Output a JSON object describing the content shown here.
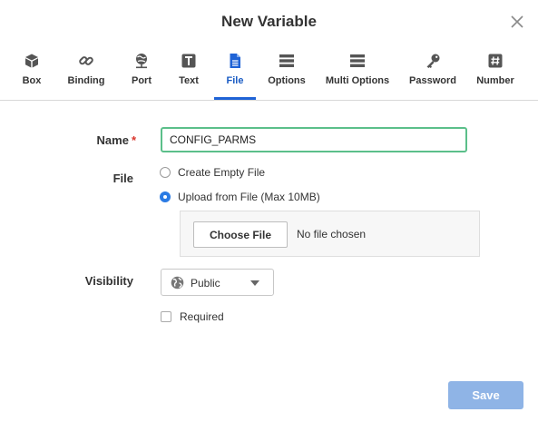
{
  "dialog": {
    "title": "New Variable",
    "close_icon": "close-icon"
  },
  "tabs": [
    {
      "label": "Box",
      "icon": "cube-icon"
    },
    {
      "label": "Binding",
      "icon": "link-icon"
    },
    {
      "label": "Port",
      "icon": "network-icon"
    },
    {
      "label": "Text",
      "icon": "text-icon"
    },
    {
      "label": "File",
      "icon": "file-icon",
      "active": true
    },
    {
      "label": "Options",
      "icon": "list-icon"
    },
    {
      "label": "Multi Options",
      "icon": "multi-list-icon"
    },
    {
      "label": "Password",
      "icon": "key-icon"
    },
    {
      "label": "Number",
      "icon": "hash-icon"
    }
  ],
  "form": {
    "name_label": "Name",
    "required_marker": "*",
    "name_value": "CONFIG_PARMS",
    "file_label": "File",
    "file_options": [
      {
        "label": "Create Empty File",
        "checked": false
      },
      {
        "label": "Upload from File (Max 10MB)",
        "checked": true
      }
    ],
    "choose_file_label": "Choose File",
    "no_file_text": "No file chosen",
    "visibility_label": "Visibility",
    "visibility_value": "Public",
    "required_checkbox_label": "Required",
    "required_checked": false
  },
  "footer": {
    "save_label": "Save"
  },
  "colors": {
    "accent": "#1f63d6",
    "input_focus_border": "#5bbf8a",
    "save_button_disabled": "#8fb4e6",
    "required_marker": "#d9342b"
  }
}
